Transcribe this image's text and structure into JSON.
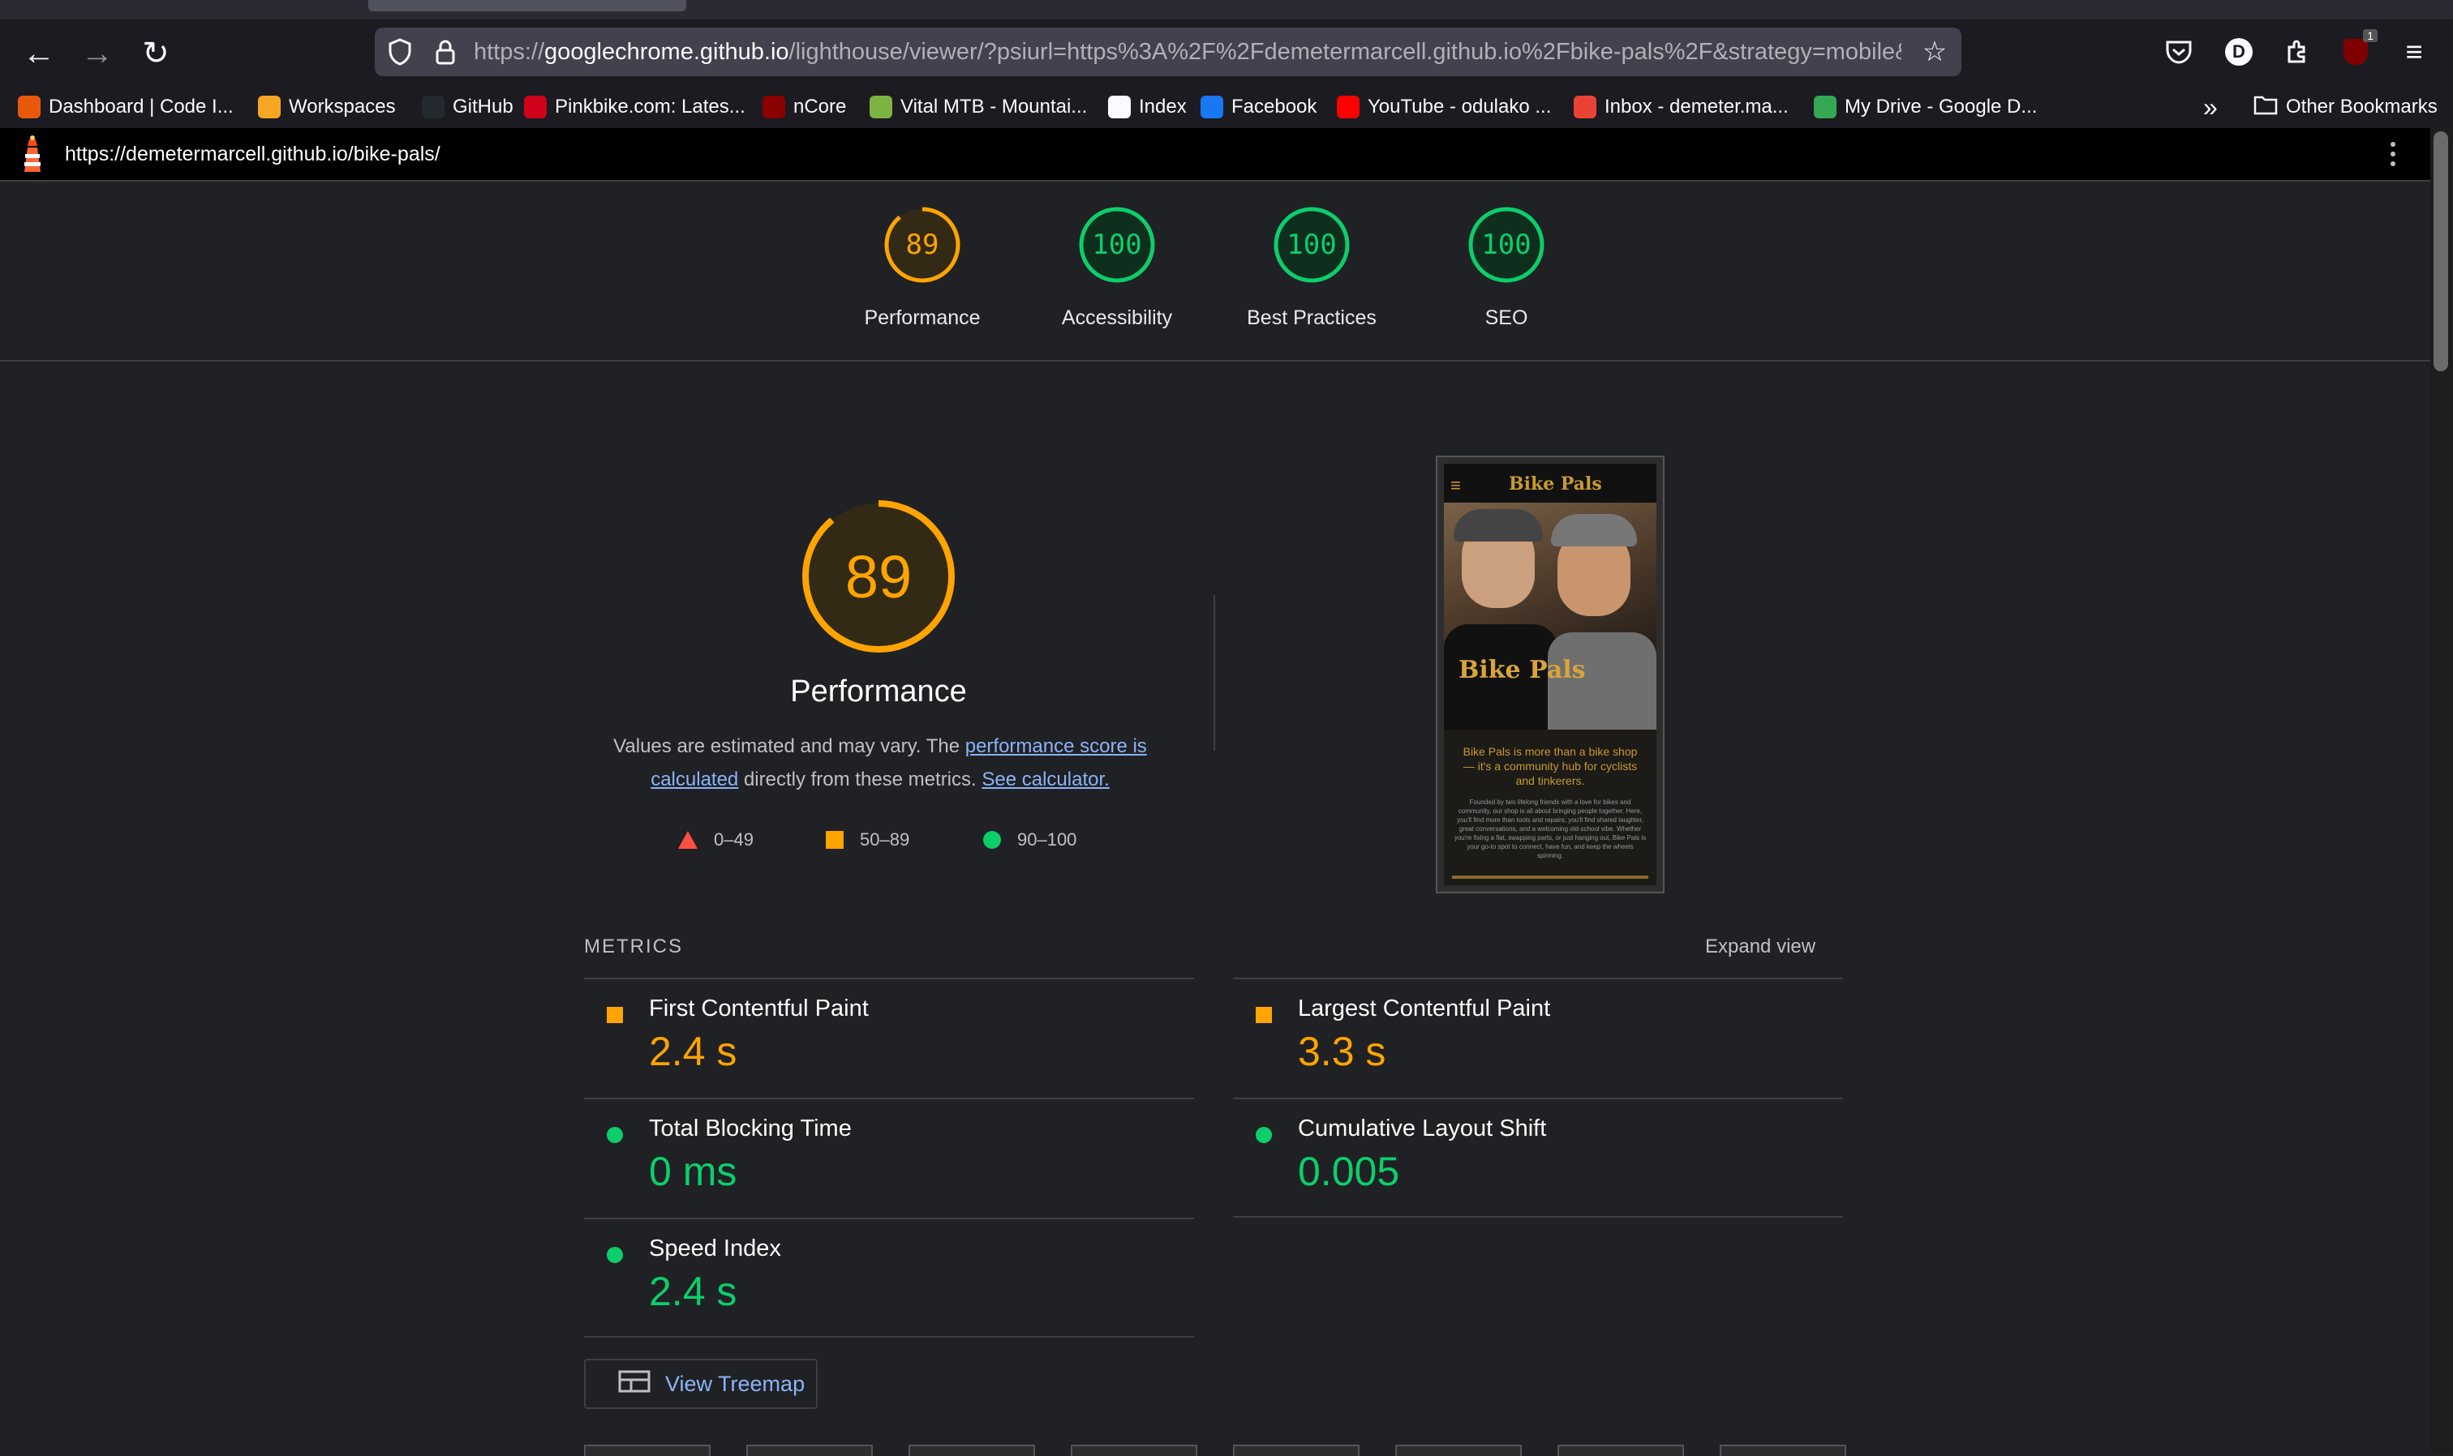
{
  "browser": {
    "url_host_prefix": "https://",
    "url_host": "googlechrome.github.io",
    "url_rest": "/lighthouse/viewer/?psiurl=https%3A%2F%2Fdemetermarcell.github.io%2Fbike-pals%2F&strategy=mobile&",
    "profile_initial": "D",
    "notification_count": "1"
  },
  "bookmarks": [
    {
      "label": "Dashboard | Code I...",
      "icon": "circle-icon",
      "color": "#e8590c"
    },
    {
      "label": "Workspaces",
      "icon": "g-logo-icon",
      "color": "#f5a623"
    },
    {
      "label": "GitHub",
      "icon": "github-icon",
      "color": "#24292f"
    },
    {
      "label": "Pinkbike.com: Lates...",
      "icon": "pb-logo-icon",
      "color": "#d0021b"
    },
    {
      "label": "nCore",
      "icon": "n-logo-icon",
      "color": "#8b0000"
    },
    {
      "label": "Vital MTB - Mountai...",
      "icon": "power-icon",
      "color": "#7cb342"
    },
    {
      "label": "Index",
      "icon": "bar-icon",
      "color": "#fbfbfe"
    },
    {
      "label": "Facebook",
      "icon": "facebook-icon",
      "color": "#1877f2"
    },
    {
      "label": "YouTube - odulako ...",
      "icon": "youtube-icon",
      "color": "#ff0000"
    },
    {
      "label": "Inbox - demeter.ma...",
      "icon": "gmail-icon",
      "color": "#ea4335"
    },
    {
      "label": "My Drive - Google D...",
      "icon": "drive-icon",
      "color": "#34a853"
    }
  ],
  "other_bookmarks": "Other Bookmarks",
  "lighthouse": {
    "tested_url": "https://demetermarcell.github.io/bike-pals/",
    "categories": [
      {
        "label": "Performance",
        "score": "89",
        "value": 0.89,
        "color": "#ffa400"
      },
      {
        "label": "Accessibility",
        "score": "100",
        "value": 1.0,
        "color": "#0cce6b"
      },
      {
        "label": "Best Practices",
        "score": "100",
        "value": 1.0,
        "color": "#0cce6b"
      },
      {
        "label": "SEO",
        "score": "100",
        "value": 1.0,
        "color": "#0cce6b"
      }
    ],
    "main": {
      "score": "89",
      "value": 0.89,
      "title": "Performance",
      "desc_before": "Values are estimated and may vary. The ",
      "desc_link": "performance score is calculated",
      "desc_mid": " directly from these metrics. ",
      "desc_calc": "See calculator."
    },
    "legend": [
      {
        "range": "0–49",
        "shape": "triangle",
        "color": "#ff4e42"
      },
      {
        "range": "50–89",
        "shape": "square",
        "color": "#ffa400"
      },
      {
        "range": "90–100",
        "shape": "circle",
        "color": "#0cce6b"
      }
    ],
    "screenshot": {
      "site_title": "Bike Pals",
      "hero_logo": "Bike Pals",
      "tagline": "Bike Pals is more than a bike shop — it's a community hub for cyclists and tinkerers.",
      "body": "Founded by two lifelong friends with a love for bikes and community, our shop is all about bringing people together. Here, you'll find more than tools and repairs; you'll find shared laughter, great conversations, and a welcoming old-school vibe. Whether you're fixing a flat, swapping parts, or just hanging out, Bike Pals is your go-to spot to connect, have fun, and keep the wheels spinning."
    },
    "metrics_header": "METRICS",
    "expand_view": "Expand view",
    "metrics": [
      {
        "name": "First Contentful Paint",
        "value": "2.4 s",
        "status": "average"
      },
      {
        "name": "Largest Contentful Paint",
        "value": "3.3 s",
        "status": "average"
      },
      {
        "name": "Total Blocking Time",
        "value": "0 ms",
        "status": "pass"
      },
      {
        "name": "Cumulative Layout Shift",
        "value": "0.005",
        "status": "pass"
      },
      {
        "name": "Speed Index",
        "value": "2.4 s",
        "status": "pass"
      }
    ],
    "treemap_label": "View Treemap"
  }
}
